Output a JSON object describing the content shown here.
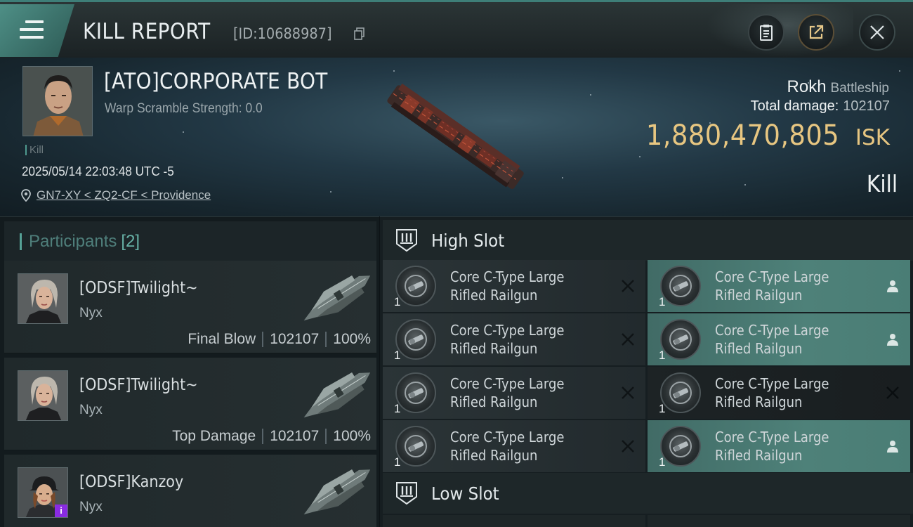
{
  "topbar": {
    "title": "KILL REPORT",
    "report_id": "[ID:10688987]"
  },
  "victim": {
    "name": "[ATO]CORPORATE BOT",
    "warp_scramble": "Warp Scramble Strength: 0.0",
    "kill_tag": "Kill",
    "datetime": "2025/05/14 22:03:48 UTC -5",
    "location": "GN7-XY < ZQ2-CF < Providence",
    "ship": "Rokh",
    "ship_class": "Battleship",
    "total_damage_label": "Total damage:",
    "total_damage": "102107",
    "isk_value": "1,880,470,805",
    "isk_unit": "ISK",
    "outcome": "Kill"
  },
  "participants": {
    "label": "Participants",
    "count": "[2]",
    "rows": [
      {
        "name": "[ODSF]Twilight~",
        "ship": "Nyx",
        "role": "Final Blow",
        "damage": "102107",
        "percent": "100%"
      },
      {
        "name": "[ODSF]Twilight~",
        "ship": "Nyx",
        "role": "Top Damage",
        "damage": "102107",
        "percent": "100%"
      },
      {
        "name": "[ODSF]Kanzoy",
        "ship": "Nyx",
        "badge": "i"
      }
    ]
  },
  "high_slot": {
    "label": "High Slot",
    "modules": [
      {
        "name_line1": "Core C-Type Large",
        "name_line2": "Rifled Railgun",
        "qty": "1",
        "status": "destroyed"
      },
      {
        "name_line1": "Core C-Type Large",
        "name_line2": "Rifled Railgun",
        "qty": "1",
        "status": "dropped"
      },
      {
        "name_line1": "Core C-Type Large",
        "name_line2": "Rifled Railgun",
        "qty": "1",
        "status": "destroyed"
      },
      {
        "name_line1": "Core C-Type Large",
        "name_line2": "Rifled Railgun",
        "qty": "1",
        "status": "dropped"
      },
      {
        "name_line1": "Core C-Type Large",
        "name_line2": "Rifled Railgun",
        "qty": "1",
        "status": "destroyed"
      },
      {
        "name_line1": "Core C-Type Large",
        "name_line2": "Rifled Railgun",
        "qty": "1",
        "status": "destroyed"
      },
      {
        "name_line1": "Core C-Type Large",
        "name_line2": "Rifled Railgun",
        "qty": "1",
        "status": "destroyed"
      },
      {
        "name_line1": "Core C-Type Large",
        "name_line2": "Rifled Railgun",
        "qty": "1",
        "status": "dropped"
      }
    ]
  },
  "low_slot": {
    "label": "Low Slot"
  },
  "colors": {
    "accent": "#4e8f86",
    "isk_gold": "#e7c681",
    "dropped_green": "#4e8179"
  },
  "icons": {
    "menu": "hamburger-icon",
    "copy": "copy-icon",
    "clipboard": "clipboard-icon",
    "share": "share-icon",
    "close": "close-icon",
    "location": "pin-icon",
    "slot": "high-slot-icon",
    "destroyed": "x-icon",
    "dropped": "person-icon"
  }
}
